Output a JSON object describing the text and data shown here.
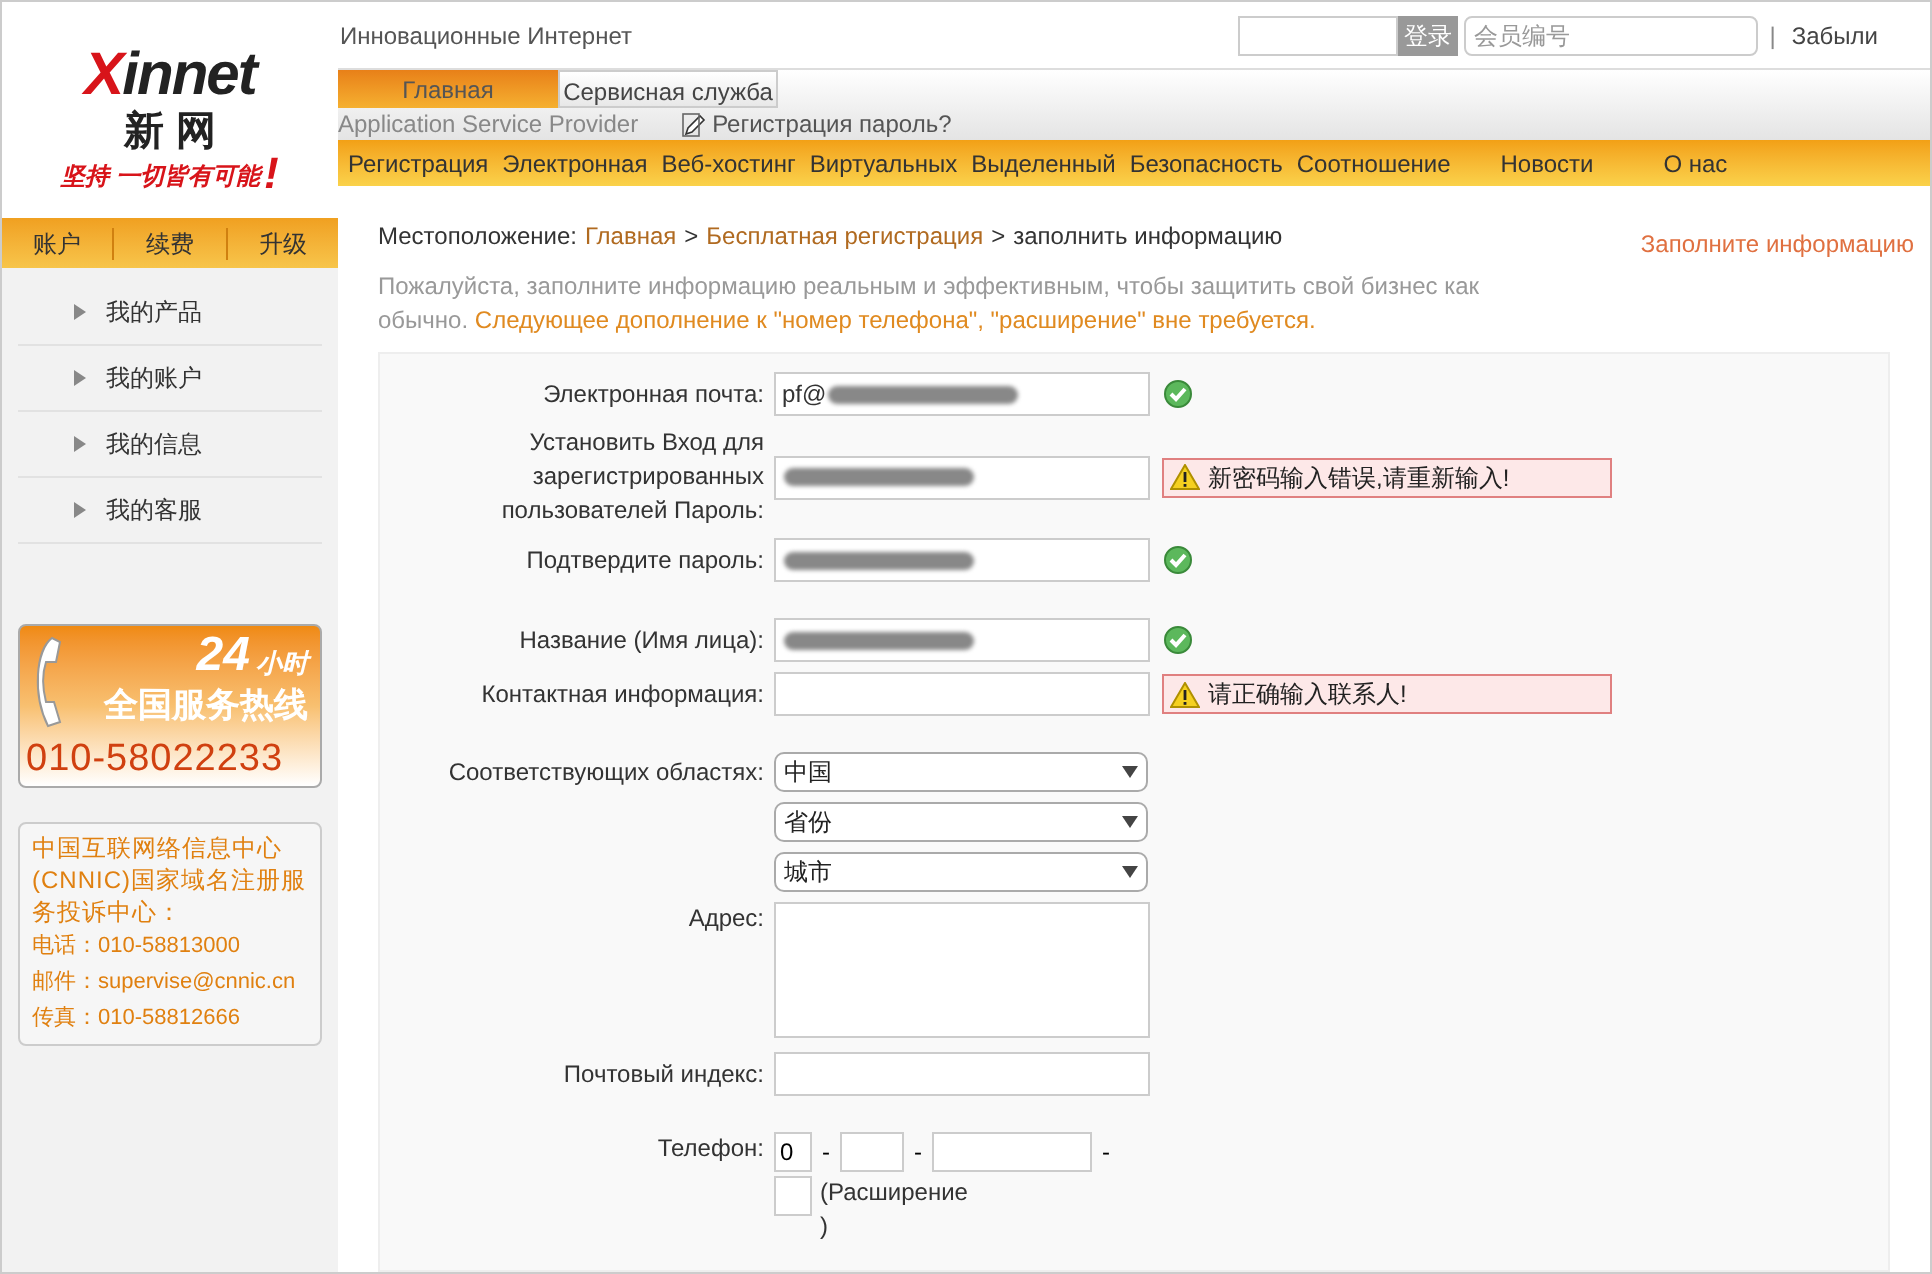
{
  "logo": {
    "wordmark": "Xinnet",
    "chinese": "新 网",
    "slogan": "坚持 一切皆有可能",
    "mark": "!"
  },
  "header": {
    "tagline": "Инновационные Интернет",
    "login_button": "登录",
    "member_placeholder": "会员编号",
    "separator": "|",
    "forgot": "Забыли"
  },
  "tabs": [
    {
      "label": "Главная",
      "selected": true
    },
    {
      "label": "Сервисная служба",
      "selected": false
    }
  ],
  "tagline_en": "Application Service Provider",
  "password_link": "Регистрация пароль?",
  "nav": [
    "Регистрация",
    "Электронная",
    "Веб-хостинг",
    "Виртуальных",
    "Выделенный",
    "Безопасность",
    "Соотношение",
    "Новости",
    "О нас"
  ],
  "sidebar": {
    "tabs": [
      "账户",
      "续费",
      "升级"
    ],
    "items": [
      "我的产品",
      "我的账户",
      "我的信息",
      "我的客服"
    ],
    "hotline": {
      "hours": "24",
      "hours_unit": "小时",
      "title": "全国服务热线",
      "number": "010-58022233"
    },
    "complaint": {
      "title": "中国互联网络信息中心(CNNIC)国家域名注册服务投诉中心：",
      "lines": [
        "电话：010-58813000",
        "邮件：supervise@cnnic.cn",
        "传真：010-58812666"
      ]
    }
  },
  "breadcrumb": {
    "prefix": "Местоположение:",
    "separator": ">",
    "items": [
      {
        "label": "Главная",
        "kind": "link"
      },
      {
        "label": "Бесплатная регистрация",
        "kind": "link"
      },
      {
        "label": "заполнить информацию",
        "kind": "current"
      }
    ]
  },
  "side_link": "Заполните информацию",
  "notice": {
    "text": "Пожалуйста, заполните информацию реальным и эффективным, чтобы защитить свой бизнес как обычно.",
    "highlight": "Следующее дополнение к \"номер телефона\", \"расширение\" вне требуется."
  },
  "form": [
    [
      {
        "kind": "text",
        "label": "Электронная почта:",
        "value": "pf@",
        "redacted": true,
        "valid": true
      },
      {
        "kind": "text",
        "label": "Установить Вход для зарегистрированных пользователей Пароль:",
        "redacted": true,
        "valid": false,
        "message": "新密码输入错误,请重新输入!"
      },
      {
        "kind": "text",
        "label": "Подтвердите пароль:",
        "redacted": true,
        "valid": true
      }
    ],
    [
      {
        "kind": "text",
        "label": "Название (Имя лица):",
        "redacted": true,
        "valid": true
      },
      {
        "kind": "text",
        "label": "Контактная информация:",
        "redacted": false,
        "valid": false,
        "message": "请正确输入联系人!"
      }
    ],
    [
      {
        "kind": "select",
        "label": "Соответствующих областях:",
        "value": "中国"
      },
      {
        "kind": "select",
        "value": "省份"
      },
      {
        "kind": "select",
        "value": "城市"
      },
      {
        "kind": "textarea",
        "label": "Адрес:"
      },
      {
        "kind": "text",
        "label": "Почтовый индекс:",
        "redacted": false
      }
    ],
    [
      {
        "kind": "phone",
        "label": "Телефон:",
        "value": "0",
        "separator": "-",
        "extension_label": "(Расширение )"
      }
    ]
  ]
}
